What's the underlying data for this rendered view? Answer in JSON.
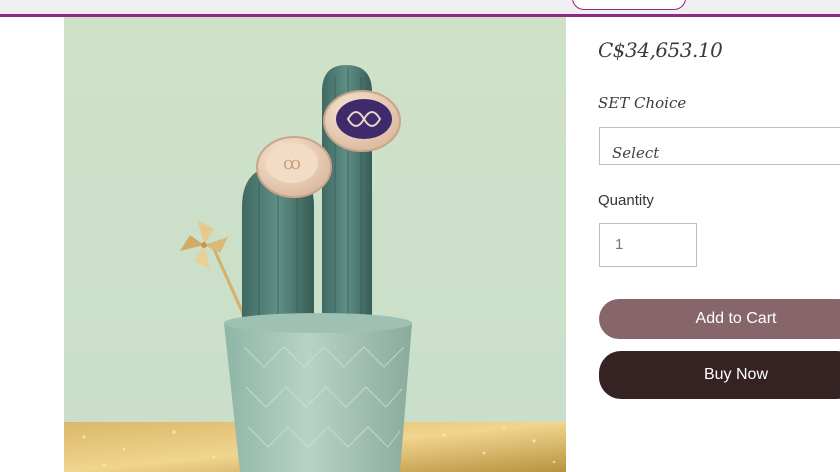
{
  "colors": {
    "accent": "#8e2a86",
    "add_to_cart_bg": "#86666a",
    "buy_now_bg": "#352222",
    "image_background": "#cfe3c8"
  },
  "product": {
    "price": "C$34,653.10",
    "option_label": "SET Choice",
    "option_select_value": "Select",
    "quantity_label": "Quantity",
    "quantity_value": "1",
    "add_to_cart_label": "Add to Cart",
    "buy_now_label": "Buy Now"
  },
  "icons": {
    "select": "chevron-down-icon"
  }
}
